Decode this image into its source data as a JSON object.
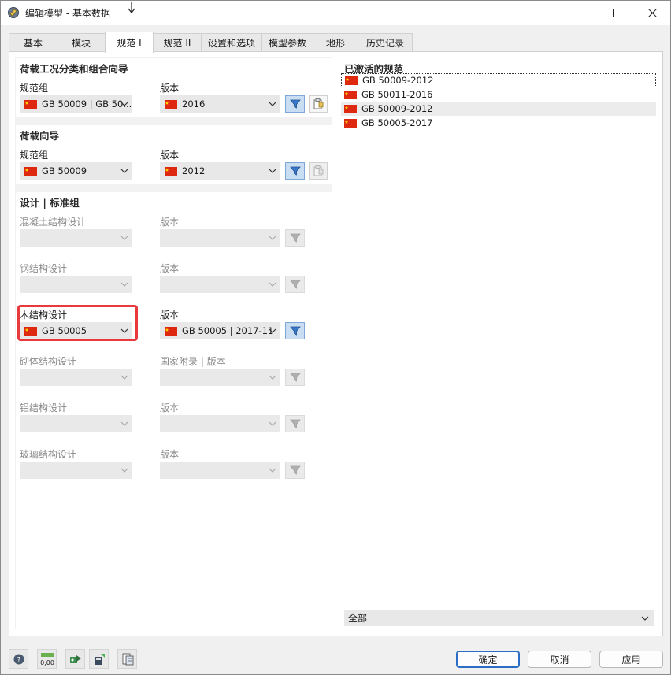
{
  "window": {
    "title": "编辑模型 - 基本数据",
    "minimize_icon": "minimize-icon",
    "maximize_icon": "maximize-icon",
    "close_icon": "close-icon"
  },
  "tabs": [
    "基本",
    "模块",
    "规范 I",
    "规范 II",
    "设置和选项",
    "模型参数",
    "地形",
    "历史记录"
  ],
  "active_tab": "规范 I",
  "load_combination_wizard": {
    "heading": "荷载工况分类和组合向导",
    "standard_group_label": "规范组",
    "standard_group_value": "GB 50009 | GB 50...",
    "edition_label": "版本",
    "edition_value": "2016"
  },
  "load_wizard": {
    "heading": "荷载向导",
    "standard_group_label": "规范组",
    "standard_group_value": "GB 50009",
    "edition_label": "版本",
    "edition_value": "2012"
  },
  "design_standards": {
    "heading": "设计 | 标准组",
    "rows": [
      {
        "label": "混凝土结构设计",
        "edition_label": "版本",
        "value": "",
        "edition_value": "",
        "enabled": false
      },
      {
        "label": "钢结构设计",
        "edition_label": "版本",
        "value": "",
        "edition_value": "",
        "enabled": false
      },
      {
        "label": "木结构设计",
        "edition_label": "版本",
        "value": "GB 50005",
        "edition_value": "GB 50005 | 2017-11",
        "enabled": true
      },
      {
        "label": "砌体结构设计",
        "edition_label": "国家附录 | 版本",
        "value": "",
        "edition_value": "",
        "enabled": false
      },
      {
        "label": "铝结构设计",
        "edition_label": "版本",
        "value": "",
        "edition_value": "",
        "enabled": false
      },
      {
        "label": "玻璃结构设计",
        "edition_label": "版本",
        "value": "",
        "edition_value": "",
        "enabled": false
      }
    ]
  },
  "active_codes": {
    "heading": "已激活的规范",
    "items": [
      "GB 50009-2012",
      "GB 50011-2016",
      "GB 50009-2012",
      "GB 50005-2017"
    ],
    "filter_value": "全部"
  },
  "footer": {
    "ok": "确定",
    "cancel": "取消",
    "apply": "应用",
    "tool_label_units": "0,00"
  },
  "colors": {
    "highlight": "#e8393c",
    "filter_active": "#c9ddf3",
    "flag_red": "#de2910",
    "flag_yellow": "#ffde00"
  }
}
